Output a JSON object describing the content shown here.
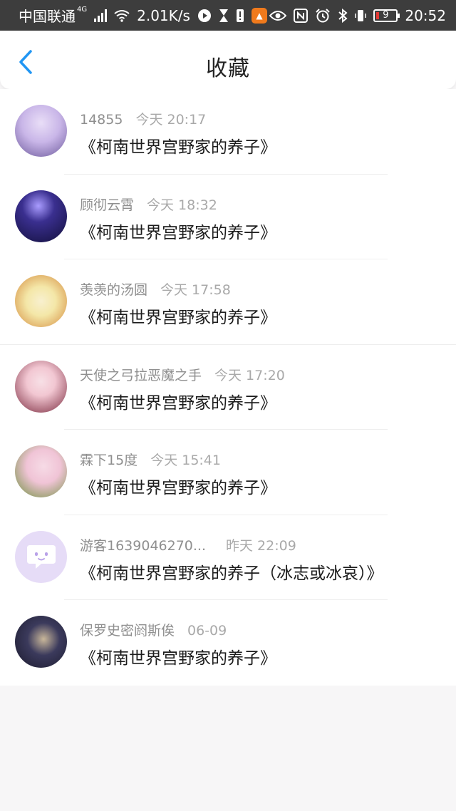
{
  "status_bar": {
    "carrier": "中国联通",
    "network_type": "4G",
    "speed": "2.01K/s",
    "battery": "9",
    "time": "20:52"
  },
  "header": {
    "title": "收藏",
    "back_icon": "chevron-left-icon",
    "accent_color": "#2196f3"
  },
  "favorites": [
    {
      "user": "14855",
      "time": "今天 20:17",
      "book": "《柯南世界宫野家的养子》",
      "avatar_colors": [
        "#c9b6e8",
        "#6d5a9c"
      ]
    },
    {
      "user": "顾彻云霄",
      "time": "今天 18:32",
      "book": "《柯南世界宫野家的养子》",
      "avatar_colors": [
        "#3a2f8f",
        "#0d0b2e"
      ]
    },
    {
      "user": "羡羡的汤圆",
      "time": "今天 17:58",
      "book": "《柯南世界宫野家的养子》",
      "avatar_colors": [
        "#f4e7a8",
        "#d48a3c"
      ]
    },
    {
      "user": "天使之弓拉恶魔之手",
      "time": "今天 17:20",
      "book": "《柯南世界宫野家的养子》",
      "avatar_colors": [
        "#f2c7d2",
        "#7a2a3e"
      ]
    },
    {
      "user": "霖下15度",
      "time": "今天 15:41",
      "book": "《柯南世界宫野家的养子》",
      "avatar_colors": [
        "#f0c4d6",
        "#6b8f3a"
      ]
    },
    {
      "user": "游客1639046270...",
      "time": "昨天 22:09",
      "book": "《柯南世界宫野家的养子（冰志或冰哀）》",
      "avatar_colors": [
        "#e6dcf7",
        "#b9a2e8"
      ]
    },
    {
      "user": "保罗史密阏斯俟",
      "time": "06-09",
      "book": "《柯南世界宫野家的养子》",
      "avatar_colors": [
        "#3b3a5c",
        "#1b1a2c"
      ]
    }
  ]
}
